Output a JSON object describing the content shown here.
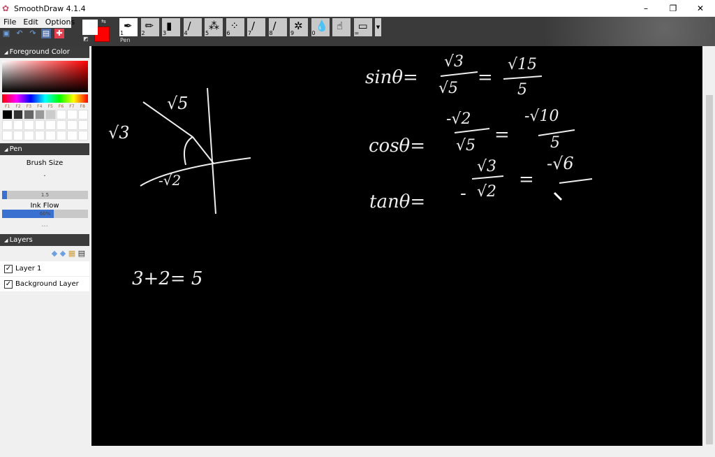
{
  "window": {
    "title": "SmoothDraw 4.1.4",
    "minimize": "–",
    "restore": "❐",
    "close": "✕"
  },
  "menu": [
    "File",
    "Edit",
    "Options"
  ],
  "colors": {
    "foreground": "#ffffff",
    "background": "#ff0000",
    "canvas": "#000000",
    "accent": "#3a70d0"
  },
  "tools": [
    {
      "key": "1",
      "name": "Pen",
      "icon": "pen-icon",
      "glyph": "✒"
    },
    {
      "key": "2",
      "icon": "pencil-icon",
      "glyph": "✏"
    },
    {
      "key": "3",
      "icon": "highlighter-icon",
      "glyph": "▮"
    },
    {
      "key": "4",
      "icon": "brush-icon",
      "glyph": "/"
    },
    {
      "key": "5",
      "icon": "airbrush-icon",
      "glyph": "⁂"
    },
    {
      "key": "6",
      "icon": "spray-icon",
      "glyph": "⁘"
    },
    {
      "key": "7",
      "icon": "flat-brush-icon",
      "glyph": "/"
    },
    {
      "key": "8",
      "icon": "ink-brush-icon",
      "glyph": "/"
    },
    {
      "key": "9",
      "icon": "sparkle-icon",
      "glyph": "✲"
    },
    {
      "key": "0",
      "icon": "water-drop-icon",
      "glyph": "💧"
    },
    {
      "key": "",
      "icon": "smudge-finger-icon",
      "glyph": "☝"
    },
    {
      "key": "=",
      "icon": "eraser-icon",
      "glyph": "▭"
    }
  ],
  "panel": {
    "foreground_title": "Foreground Color",
    "fkeys": [
      "F1",
      "F2",
      "F3",
      "F4",
      "F5",
      "F6",
      "F7",
      "F8"
    ],
    "swatches": [
      "#000000",
      "#333333",
      "#666666",
      "#999999",
      "#cccccc",
      "#ffffff",
      "#ffffff",
      "#ffffff"
    ],
    "pen_title": "Pen",
    "brush_size_label": "Brush Size",
    "brush_size": "1.5",
    "ink_flow_label": "Ink Flow",
    "ink_flow": "60%",
    "more": "...",
    "layers_title": "Layers",
    "layers": [
      {
        "name": "Layer 1",
        "visible": true
      },
      {
        "name": "Background Layer",
        "visible": true
      }
    ]
  },
  "canvas": {
    "diagram": {
      "hyp": "√5",
      "opp": "√3",
      "adj": "-√2"
    },
    "sum": "3+2= 5",
    "sin": {
      "lhs": "sinθ=",
      "num1": "√3",
      "den1": "√5",
      "eq": "=",
      "num2": "√15",
      "den2": "5"
    },
    "cos": {
      "lhs": "cosθ=",
      "num1": "-√2",
      "den1": "√5",
      "eq": "=",
      "num2": "-√10",
      "den2": "5"
    },
    "tan": {
      "lhs": "tanθ=",
      "num1": "√3",
      "den1": "√2",
      "neg": "-",
      "eq": "=",
      "num2": "-√6"
    }
  }
}
